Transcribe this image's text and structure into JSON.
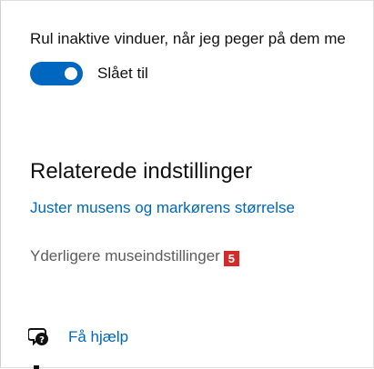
{
  "scroll_inactive": {
    "label": "Rul inaktive vinduer, når jeg peger på dem me",
    "toggle_on": true,
    "toggle_state_label": "Slået til"
  },
  "related": {
    "heading": "Relaterede indstillinger",
    "link_mouse_pointer_size": "Juster musens og markørens størrelse",
    "link_additional_mouse": "Yderligere museindstillinger",
    "badge_number": "5"
  },
  "help": {
    "icon": "help-chat-icon",
    "label": "Få hjælp"
  },
  "colors": {
    "accent": "#0067c0",
    "link": "#0067b8",
    "badge": "#d32a2a"
  }
}
